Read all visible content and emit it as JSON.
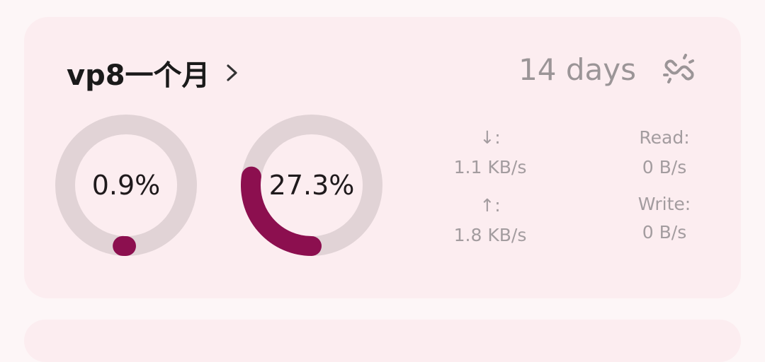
{
  "card": {
    "title": "vp8一个月",
    "days_label": "14 days",
    "chevron_icon": "chevron-right-icon",
    "link_icon": "link-off-icon"
  },
  "gauges": [
    {
      "label": "0.9%",
      "value": 0.9
    },
    {
      "label": "27.3%",
      "value": 27.3
    }
  ],
  "net": {
    "down_label": "↓:",
    "down_value": "1.1 KB/s",
    "up_label": "↑:",
    "up_value": "1.8 KB/s"
  },
  "disk": {
    "read_label": "Read:",
    "read_value": "0 B/s",
    "write_label": "Write:",
    "write_value": "0 B/s"
  },
  "colors": {
    "accent": "#8c0f4f",
    "track": "#e1d3d6",
    "card_bg": "#fcedf0",
    "page_bg": "#fdf6f7"
  }
}
